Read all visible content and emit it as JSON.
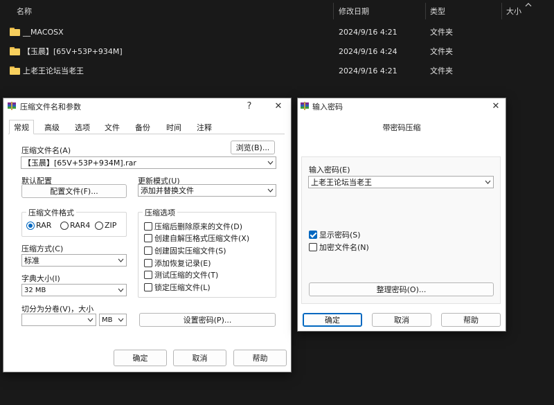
{
  "explorer": {
    "columns": {
      "name": "名称",
      "modified": "修改日期",
      "type": "类型",
      "size": "大小"
    },
    "files": [
      {
        "name": "__MACOSX",
        "modified": "2024/9/16 4:21",
        "type": "文件夹"
      },
      {
        "name": "【玉晨】[65V+53P+934M]",
        "modified": "2024/9/16 4:24",
        "type": "文件夹"
      },
      {
        "name": "上老王论坛当老王",
        "modified": "2024/9/16 4:21",
        "type": "文件夹"
      }
    ]
  },
  "archive_dialog": {
    "title": "压缩文件名和参数",
    "help_glyph": "?",
    "close_glyph": "✕",
    "tabs": [
      "常规",
      "高级",
      "选项",
      "文件",
      "备份",
      "时间",
      "注释"
    ],
    "archive_name_label": "压缩文件名(A)",
    "browse_label": "浏览(B)...",
    "archive_name_value": "【玉晨】[65V+53P+934M].rar",
    "default_profile_label": "默认配置",
    "profile_button_label": "配置文件(F)...",
    "update_mode_label": "更新模式(U)",
    "update_mode_value": "添加并替换文件",
    "format_group_label": "压缩文件格式",
    "formats": [
      "RAR",
      "RAR4",
      "ZIP"
    ],
    "selected_format": "RAR",
    "options_group_label": "压缩选项",
    "options": [
      {
        "label": "压缩后删除原来的文件(D)",
        "checked": false
      },
      {
        "label": "创建自解压格式压缩文件(X)",
        "checked": false
      },
      {
        "label": "创建固实压缩文件(S)",
        "checked": false
      },
      {
        "label": "添加恢复记录(E)",
        "checked": false
      },
      {
        "label": "测试压缩的文件(T)",
        "checked": false
      },
      {
        "label": "锁定压缩文件(L)",
        "checked": false
      }
    ],
    "method_label": "压缩方式(C)",
    "method_value": "标准",
    "dict_label": "字典大小(I)",
    "dict_value": "32 MB",
    "split_label": "切分为分卷(V)，大小",
    "split_value": "",
    "split_unit": "MB",
    "set_password_label": "设置密码(P)...",
    "ok_label": "确定",
    "cancel_label": "取消",
    "help_label": "帮助"
  },
  "password_dialog": {
    "title": "输入密码",
    "close_glyph": "✕",
    "heading": "带密码压缩",
    "password_label": "输入密码(E)",
    "password_value": "上老王论坛当老王",
    "show_password_label": "显示密码(S)",
    "show_password_checked": true,
    "encrypt_names_label": "加密文件名(N)",
    "encrypt_names_checked": false,
    "organize_label": "整理密码(O)...",
    "ok_label": "确定",
    "cancel_label": "取消",
    "help_label": "帮助"
  },
  "colors": {
    "accent": "#0067c0",
    "folder": "#f7cf5d",
    "background": "#191919"
  },
  "icons": [
    "folder-icon",
    "winrar-icon",
    "chevron-down-icon",
    "chevron-up-icon",
    "close-icon",
    "help-icon",
    "check-icon"
  ]
}
